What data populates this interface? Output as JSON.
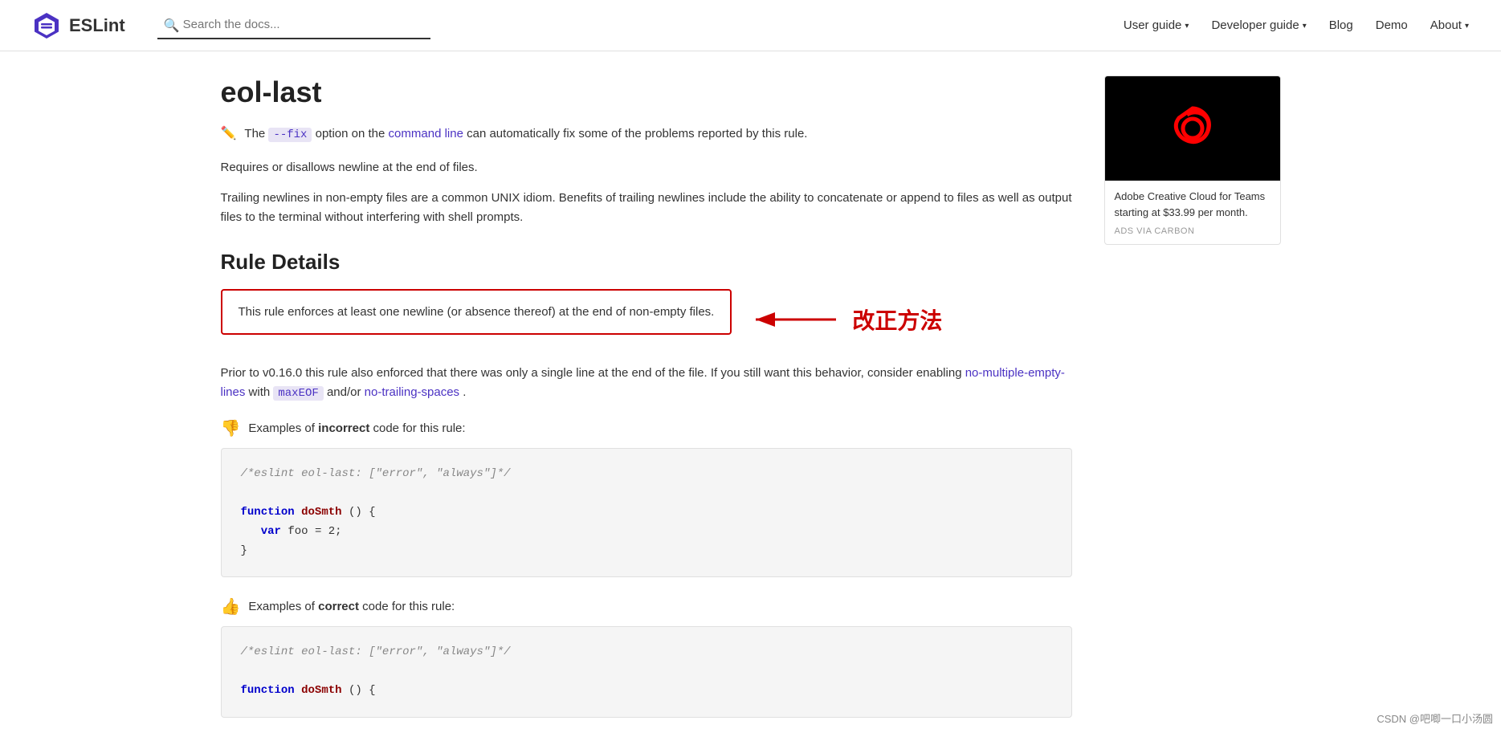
{
  "navbar": {
    "brand_name": "ESLint",
    "search_placeholder": "Search the docs...",
    "nav_items": [
      {
        "label": "User guide",
        "has_dropdown": true
      },
      {
        "label": "Developer guide",
        "has_dropdown": true
      },
      {
        "label": "Blog",
        "has_dropdown": false
      },
      {
        "label": "Demo",
        "has_dropdown": false
      },
      {
        "label": "About",
        "has_dropdown": true
      }
    ]
  },
  "page": {
    "title": "eol-last",
    "fix_notice": {
      "prefix": "The ",
      "fix_option": "--fix",
      "middle": " option on the ",
      "link_text": "command line",
      "suffix": " can automatically fix some of the problems reported by this rule."
    },
    "description1": "Requires or disallows newline at the end of files.",
    "description2": "Trailing newlines in non-empty files are a common UNIX idiom. Benefits of trailing newlines include the ability to concatenate or append to files as well as output files to the terminal without interfering with shell prompts.",
    "rule_details_title": "Rule Details",
    "highlight_text": "This rule enforces at least one newline (or absence thereof) at the end of non-empty files.",
    "annotation_text": "改正方法",
    "prior_text_1": "Prior to v0.16.0 this rule also enforced that there was only a single line at the end of the file. If you still want this behavior, consider enabling ",
    "prior_link": "no-multiple-empty-lines",
    "prior_text_2": " with ",
    "prior_badge": "maxEOF",
    "prior_text_3": " and/or ",
    "prior_link2": "no-trailing-spaces",
    "prior_text_4": ".",
    "incorrect_label": "Examples of ",
    "incorrect_bold": "incorrect",
    "incorrect_suffix": " code for this rule:",
    "correct_label": "Examples of ",
    "correct_bold": "correct",
    "correct_suffix": " code for this rule:",
    "incorrect_code": {
      "comment": "/*eslint eol-last: [\"error\", \"always\"]*/",
      "line1": "",
      "line2": "function doSmth() {",
      "line3": "  var foo = 2;",
      "line4": "}"
    },
    "correct_code": {
      "comment": "/*eslint eol-last: [\"error\", \"always\"]*/",
      "line1": "",
      "line2": "function doSmth() {"
    }
  },
  "ad": {
    "title": "Adobe Creative Cloud for Teams starting at $33.99 per month.",
    "label": "ADS VIA CARBON"
  },
  "watermark": "CSDN @吧唧一口小汤圆"
}
